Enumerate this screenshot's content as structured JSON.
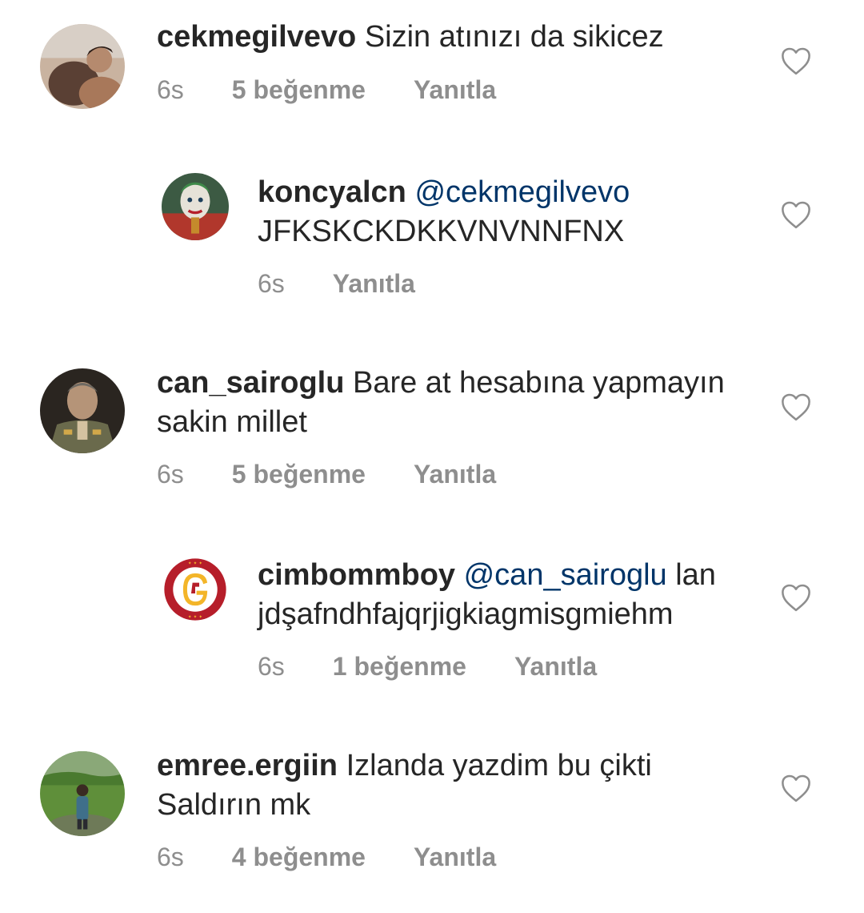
{
  "comments": [
    {
      "username": "cekmegilvevo",
      "mention": "",
      "text": "Sizin atınızı da sikicez",
      "time": "6s",
      "likes": "5 beğenme",
      "reply_label": "Yanıtla"
    },
    {
      "username": "koncyalcn",
      "mention": "@cekmegilvevo",
      "text": "JFKSKCKDKKVNVNNFNX",
      "time": "6s",
      "likes": "",
      "reply_label": "Yanıtla"
    },
    {
      "username": "can_sairoglu",
      "mention": "",
      "text": "Bare at hesabına yapmayın sakin millet",
      "time": "6s",
      "likes": "5 beğenme",
      "reply_label": "Yanıtla"
    },
    {
      "username": "cimbommboy",
      "mention": "@can_sairoglu",
      "text": "lan jdşafndhfajqrjigkiagmisgmiehm",
      "time": "6s",
      "likes": "1 beğenme",
      "reply_label": "Yanıtla"
    },
    {
      "username": "emree.ergiin",
      "mention": "",
      "text": "Izlanda yazdim bu çikti Saldırın mk",
      "time": "6s",
      "likes": "4 beğenme",
      "reply_label": "Yanıtla"
    }
  ],
  "colors": {
    "text": "#262626",
    "muted": "#8e8e8e",
    "mention": "#003569"
  },
  "icons": {
    "like": "heart-outline-icon"
  }
}
